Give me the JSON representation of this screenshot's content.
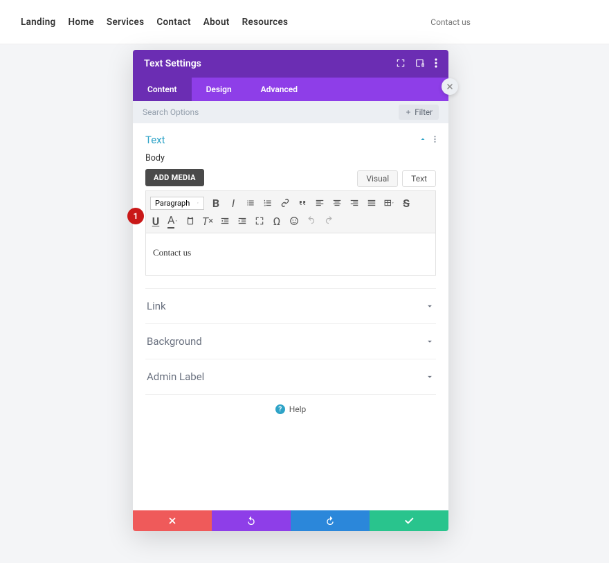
{
  "nav": {
    "items": [
      "Landing",
      "Home",
      "Services",
      "Contact",
      "About",
      "Resources"
    ]
  },
  "topbar_right": "Contact us",
  "panel": {
    "title": "Text Settings",
    "tabs": [
      "Content",
      "Design",
      "Advanced"
    ],
    "active_tab": 0
  },
  "search": {
    "placeholder": "Search Options",
    "filter_label": "Filter"
  },
  "text_section": {
    "title": "Text",
    "body_label": "Body",
    "add_media": "ADD MEDIA",
    "editor_tabs": {
      "visual": "Visual",
      "text": "Text"
    },
    "paragraph_label": "Paragraph",
    "content": "Contact us"
  },
  "sections": [
    {
      "title": "Link"
    },
    {
      "title": "Background"
    },
    {
      "title": "Admin Label"
    }
  ],
  "help_label": "Help",
  "step_badge": "1"
}
